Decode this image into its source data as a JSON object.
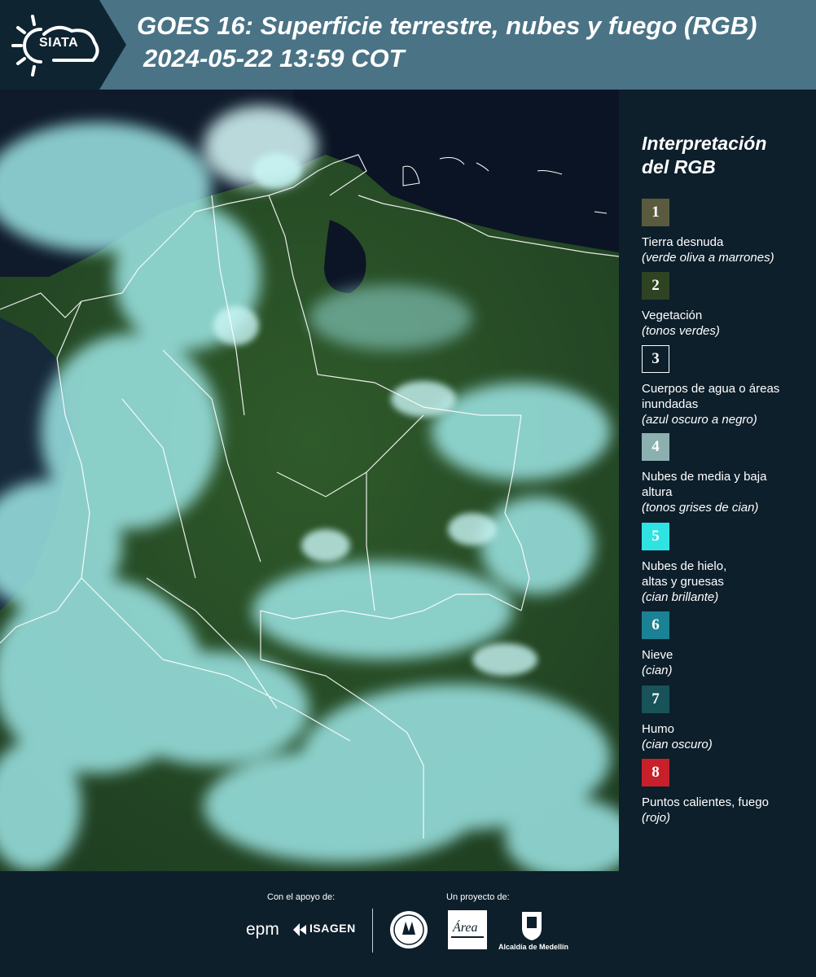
{
  "header": {
    "logo_text": "SIATA",
    "title": "GOES 16: Superficie terrestre, nubes y fuego (RGB)",
    "timestamp": "2024-05-22 13:59 COT"
  },
  "map": {
    "region": "Colombia"
  },
  "legend": {
    "title_line1": "Interpretación",
    "title_line2": "del RGB",
    "items": [
      {
        "number": "1",
        "label": "Tierra desnuda",
        "desc": "(verde oliva a marrones)",
        "color": "#5a5a3e"
      },
      {
        "number": "2",
        "label": "Vegetación",
        "desc": "(tonos verdes)",
        "color": "#2e4322"
      },
      {
        "number": "3",
        "label": "Cuerpos de agua o áreas inundadas",
        "desc": "(azul oscuro a negro)",
        "color": "#0d1f2b"
      },
      {
        "number": "4",
        "label": "Nubes de media y baja altura",
        "desc": "(tonos grises de cian)",
        "color": "#8cb0b0"
      },
      {
        "number": "5",
        "label": "Nubes de hielo, altas y gruesas",
        "desc": "(cian brillante)",
        "color": "#2fe3e3"
      },
      {
        "number": "6",
        "label": "Nieve",
        "desc": "(cian)",
        "color": "#1a8294"
      },
      {
        "number": "7",
        "label": "Humo",
        "desc": "(cian oscuro)",
        "color": "#18535a"
      },
      {
        "number": "8",
        "label": "Puntos calientes, fuego",
        "desc": "(rojo)",
        "color": "#c8202a"
      }
    ]
  },
  "footer": {
    "support_label": "Con el apoyo de:",
    "project_label": "Un proyecto de:",
    "epm": "epm",
    "isagen": "ISAGEN",
    "alcaldia": "Alcaldía de Medellín",
    "area_metropolitana": "Área"
  }
}
